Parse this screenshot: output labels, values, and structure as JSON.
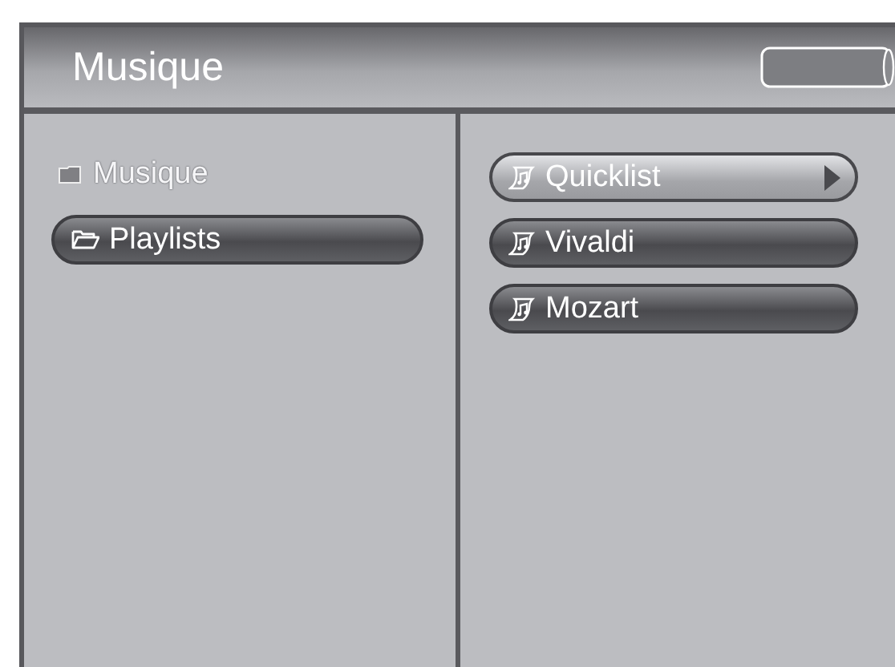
{
  "header": {
    "title": "Musique"
  },
  "left_pane": {
    "items": [
      {
        "label": "Musique",
        "selected": false,
        "disabled": true
      },
      {
        "label": "Playlists",
        "selected": true,
        "disabled": false
      }
    ]
  },
  "right_pane": {
    "items": [
      {
        "label": "Quicklist",
        "selected": true
      },
      {
        "label": "Vivaldi",
        "selected": false
      },
      {
        "label": "Mozart",
        "selected": false
      }
    ]
  }
}
